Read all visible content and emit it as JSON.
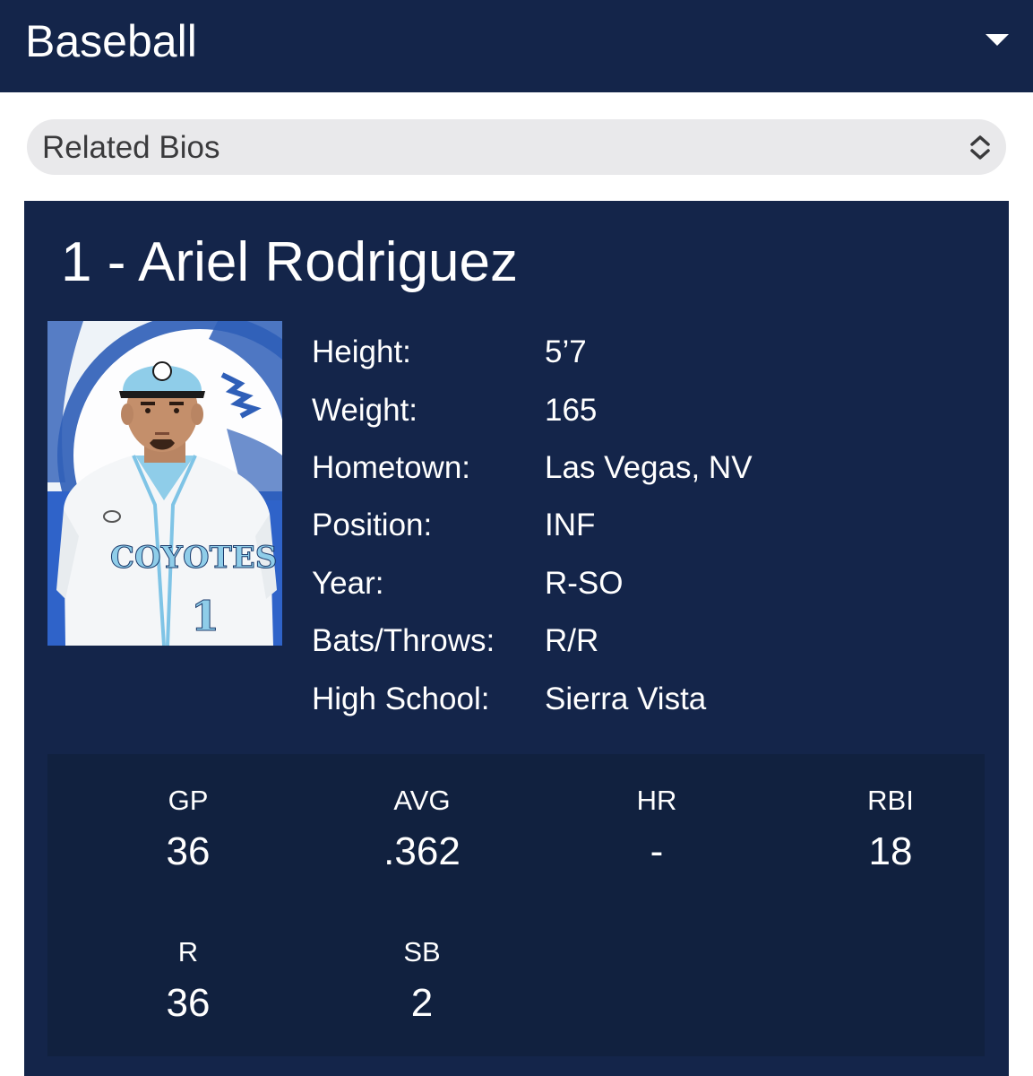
{
  "header": {
    "sport": "Baseball",
    "menu_icon": "caret-down-icon"
  },
  "related_bios": {
    "selected": "Related Bios",
    "icon": "select-chevrons-icon"
  },
  "player": {
    "title": "1 - Ariel Rodriguez",
    "photo_jersey_text": "COYOTES",
    "photo_jersey_number": "1",
    "bio": [
      {
        "label": "Height:",
        "value": "5’7"
      },
      {
        "label": "Weight:",
        "value": "165"
      },
      {
        "label": "Hometown:",
        "value": "Las Vegas, NV"
      },
      {
        "label": "Position:",
        "value": "INF"
      },
      {
        "label": "Year:",
        "value": "R-SO"
      },
      {
        "label": "Bats/Throws:",
        "value": "R/R"
      },
      {
        "label": "High School:",
        "value": "Sierra Vista"
      }
    ]
  },
  "stats": [
    {
      "label": "GP",
      "value": "36"
    },
    {
      "label": "AVG",
      "value": ".362"
    },
    {
      "label": "HR",
      "value": "-"
    },
    {
      "label": "RBI",
      "value": "18"
    },
    {
      "label": "R",
      "value": "36"
    },
    {
      "label": "SB",
      "value": "2"
    }
  ],
  "colors": {
    "navy": "#14254a",
    "stats_bg": "#11213f",
    "select_bg": "#e9e9eb",
    "jersey_blue": "#7fc4e6"
  }
}
